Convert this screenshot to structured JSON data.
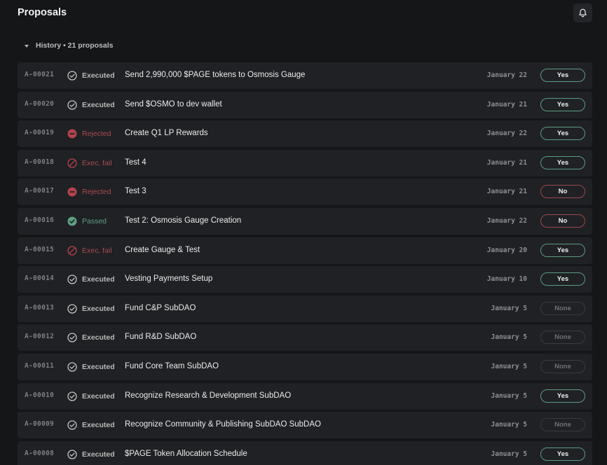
{
  "header": {
    "title": "Proposals",
    "bell_icon": "bell-icon"
  },
  "history": {
    "label": "History • 21 proposals"
  },
  "colors": {
    "background": "#151618",
    "row": "#202124",
    "executed": "#b9b9b9",
    "rejected": "#a84b52",
    "passed": "#5f9e84",
    "vote_yes_border": "#5a9c82",
    "vote_no_border": "#9b4750"
  },
  "proposals": [
    {
      "id": "A-00021",
      "status": "executed",
      "status_label": "Executed",
      "title": "Send 2,990,000 $PAGE tokens to Osmosis Gauge",
      "date": "January 22",
      "vote": "yes",
      "vote_label": "Yes"
    },
    {
      "id": "A-00020",
      "status": "executed",
      "status_label": "Executed",
      "title": "Send $OSMO to dev wallet",
      "date": "January 21",
      "vote": "yes",
      "vote_label": "Yes"
    },
    {
      "id": "A-00019",
      "status": "rejected",
      "status_label": "Rejected",
      "title": "Create Q1 LP Rewards",
      "date": "January 22",
      "vote": "yes",
      "vote_label": "Yes"
    },
    {
      "id": "A-00018",
      "status": "execfail",
      "status_label": "Exec. fail",
      "title": "Test 4",
      "date": "January 21",
      "vote": "yes",
      "vote_label": "Yes"
    },
    {
      "id": "A-00017",
      "status": "rejected",
      "status_label": "Rejected",
      "title": "Test 3",
      "date": "January 21",
      "vote": "no",
      "vote_label": "No"
    },
    {
      "id": "A-00016",
      "status": "passed",
      "status_label": "Passed",
      "title": "Test 2: Osmosis Gauge Creation",
      "date": "January 22",
      "vote": "no",
      "vote_label": "No"
    },
    {
      "id": "A-00015",
      "status": "execfail",
      "status_label": "Exec. fail",
      "title": "Create Gauge & Test",
      "date": "January 20",
      "vote": "yes",
      "vote_label": "Yes"
    },
    {
      "id": "A-00014",
      "status": "executed",
      "status_label": "Executed",
      "title": "Vesting Payments Setup",
      "date": "January 10",
      "vote": "yes",
      "vote_label": "Yes"
    },
    {
      "id": "A-00013",
      "status": "executed",
      "status_label": "Executed",
      "title": "Fund C&P SubDAO",
      "date": "January 5",
      "vote": "none",
      "vote_label": "None"
    },
    {
      "id": "A-00012",
      "status": "executed",
      "status_label": "Executed",
      "title": "Fund R&D SubDAO",
      "date": "January 5",
      "vote": "none",
      "vote_label": "None"
    },
    {
      "id": "A-00011",
      "status": "executed",
      "status_label": "Executed",
      "title": "Fund Core Team SubDAO",
      "date": "January 5",
      "vote": "none",
      "vote_label": "None"
    },
    {
      "id": "A-00010",
      "status": "executed",
      "status_label": "Executed",
      "title": "Recognize Research & Development SubDAO",
      "date": "January 5",
      "vote": "yes",
      "vote_label": "Yes"
    },
    {
      "id": "A-00009",
      "status": "executed",
      "status_label": "Executed",
      "title": "Recognize Community & Publishing SubDAO SubDAO",
      "date": "January 5",
      "vote": "none",
      "vote_label": "None"
    },
    {
      "id": "A-00008",
      "status": "executed",
      "status_label": "Executed",
      "title": "$PAGE Token Allocation Schedule",
      "date": "January 5",
      "vote": "yes",
      "vote_label": "Yes"
    }
  ]
}
